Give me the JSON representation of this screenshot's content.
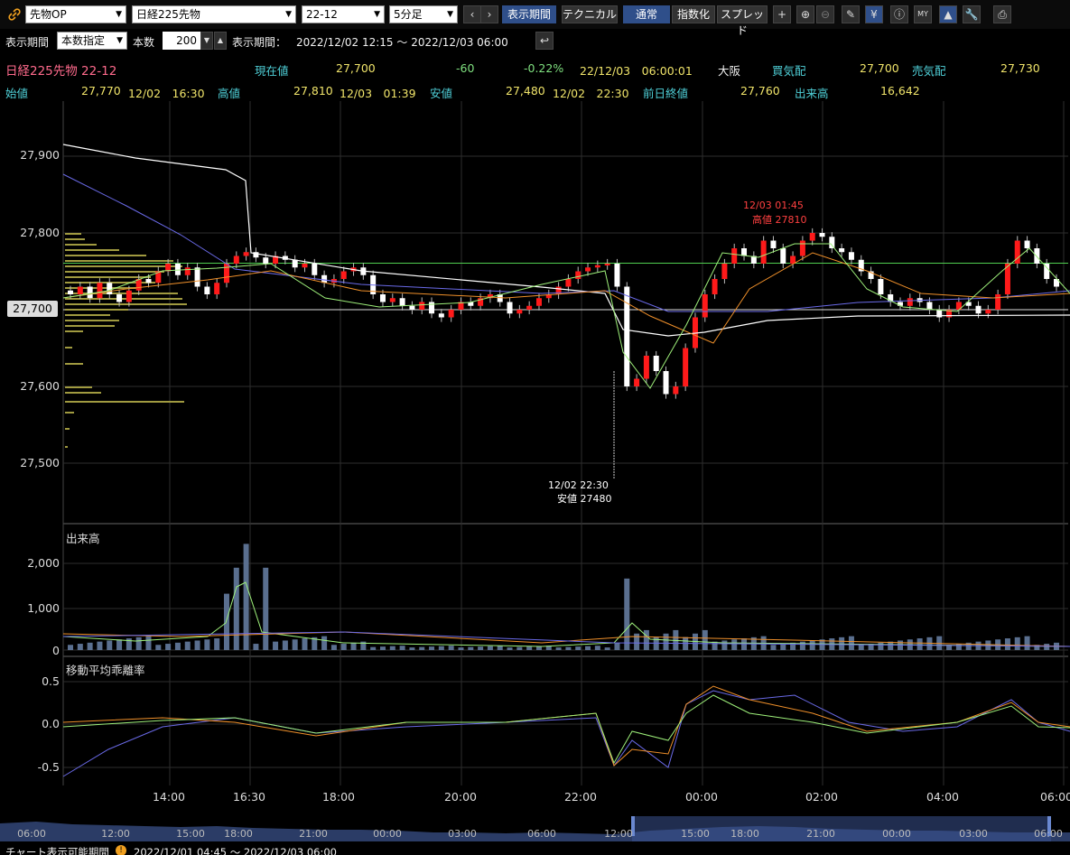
{
  "toolbar": {
    "link_icon": "link-icon",
    "product_select": "先物OP",
    "instrument_select": "日経225先物",
    "contract_select": "22-12",
    "interval_select": "5分足",
    "btn_period": "表示期間",
    "btn_technical": "テクニカル",
    "btn_normal": "通常",
    "btn_index": "指数化",
    "btn_spread": "スプレッド",
    "icons": [
      "crosshair-icon",
      "zoom-in-icon",
      "zoom-out-icon",
      "pencil-icon",
      "yen-icon",
      "info-icon",
      "my-indicator-icon",
      "area-chart-icon",
      "wrench-icon",
      "print-icon"
    ]
  },
  "period_bar": {
    "label1": "表示期間",
    "mode_select": "本数指定",
    "count_label": "本数",
    "count_value": "200",
    "label2": "表示期間：",
    "range": "2022/12/02 12:15 ～ 2022/12/03 06:00",
    "reset_icon": "reset-icon"
  },
  "quote": {
    "name": "日経225先物 22-12",
    "current_label": "現在値",
    "current": "27,700",
    "change": "-60",
    "change_pct": "-0.22%",
    "datetime": "22/12/03　06:00:01",
    "exchange": "大阪",
    "bid_label": "買気配",
    "bid": "27,700",
    "ask_label": "売気配",
    "ask": "27,730",
    "open_label": "始値",
    "open": "27,770",
    "open_time": "12/02　16:30",
    "high_label": "高値",
    "high": "27,810",
    "high_time": "12/03　01:39",
    "low_label": "安値",
    "low": "27,480",
    "low_time": "12/02　22:30",
    "prev_close_label": "前日終値",
    "prev_close": "27,760",
    "volume_label": "出来高",
    "volume": "16,642"
  },
  "price_axis": [
    "27,900",
    "27,800",
    "27,700",
    "27,600",
    "27,500"
  ],
  "current_price_tag": "27,700",
  "annotations": {
    "high_line1": "12/03 01:45",
    "high_line2": "高値 27810",
    "low_line1": "12/02 22:30",
    "low_line2": "安値 27480"
  },
  "volume_panel": {
    "title": "出来高",
    "axis": [
      "2,000",
      "1,000",
      "0"
    ]
  },
  "deviation_panel": {
    "title": "移動平均乖離率",
    "axis": [
      "0.5",
      "0.0",
      "-0.5"
    ]
  },
  "time_axis": [
    "14:00",
    "16:30",
    "18:00",
    "20:00",
    "22:00",
    "00:00",
    "02:00",
    "04:00",
    "06:00"
  ],
  "overview_axis": [
    "06:00",
    "12:00",
    "15:00",
    "18:00",
    "21:00",
    "00:00",
    "03:00",
    "06:00",
    "12:00",
    "15:00",
    "18:00",
    "21:00",
    "00:00",
    "03:00",
    "06:00"
  ],
  "status": {
    "label": "チャート表示可能期間",
    "range": "2022/12/01 04:45 ～ 2022/12/03 06:00"
  },
  "colors": {
    "up": "#ff1a1a",
    "down": "#ffffff",
    "ma_short": "#9ef07a",
    "ma_mid": "#f0902a",
    "ma_long": "#6a6ae8",
    "vwap": "#ffffff",
    "prev_close_line": "#50d050",
    "accent_blue": "#2f4f8a"
  }
}
